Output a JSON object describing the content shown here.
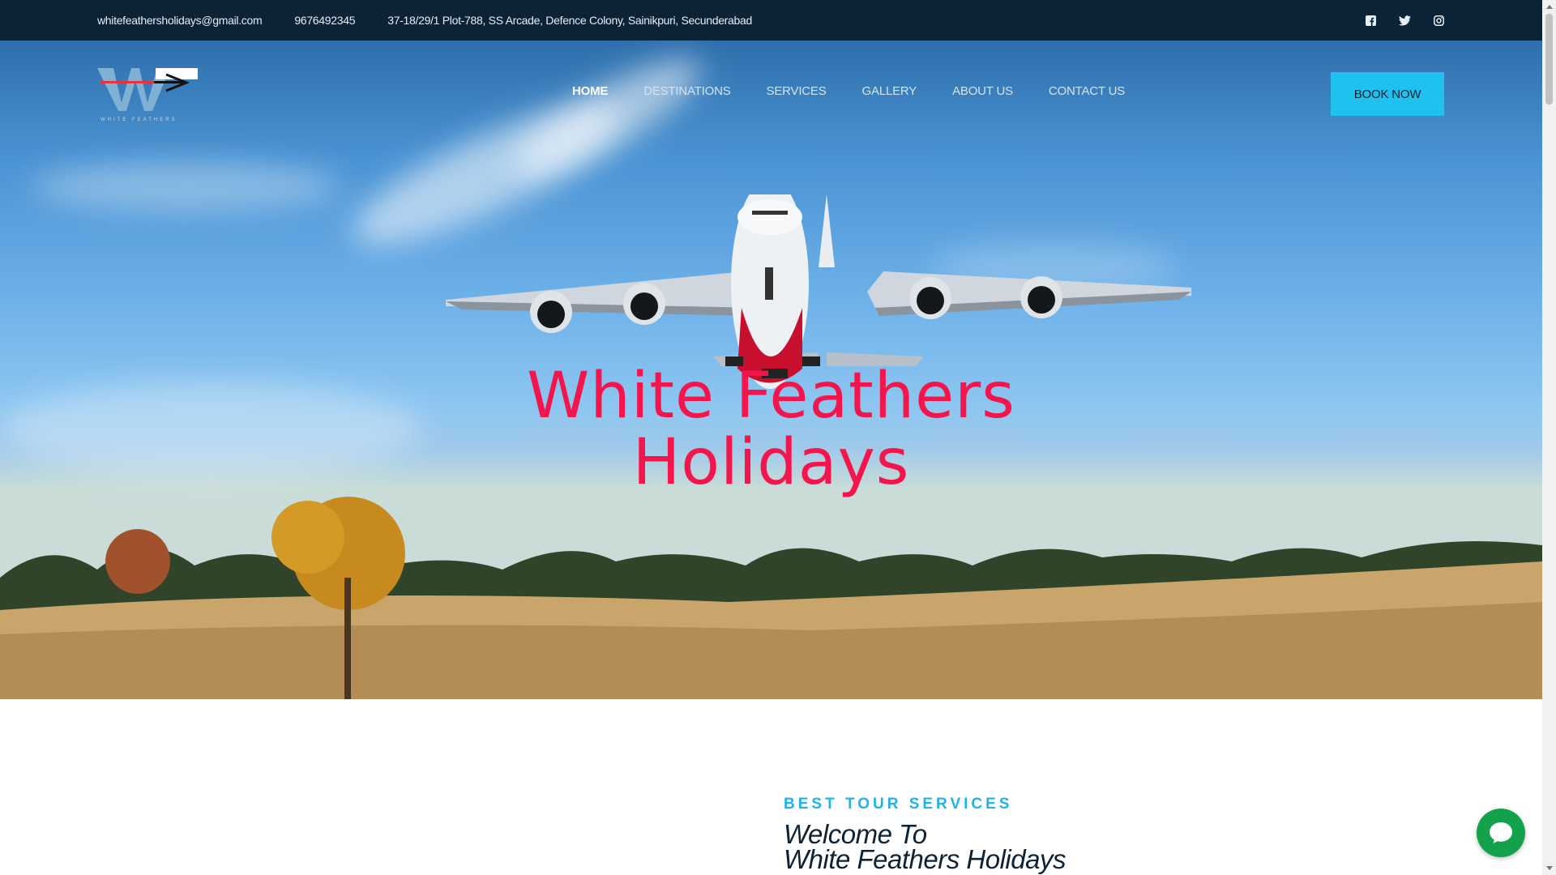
{
  "topbar": {
    "email": "whitefeathersholidays@gmail.com",
    "phone": "9676492345",
    "address": "37-18/29/1 Plot-788, SS Arcade, Defence Colony, Sainikpuri, Secunderabad",
    "social_icons": [
      "facebook-icon",
      "twitter-icon",
      "instagram-icon"
    ]
  },
  "brand": {
    "logo_text": "WHITE FEATHERS"
  },
  "nav": {
    "items": [
      {
        "label": "HOME",
        "active": true
      },
      {
        "label": "DESTINATIONS"
      },
      {
        "label": "SERVICES"
      },
      {
        "label": "GALLERY"
      },
      {
        "label": "ABOUT US"
      },
      {
        "label": "CONTACT US"
      }
    ],
    "cta": "BOOK NOW"
  },
  "hero": {
    "title_line1": "White Feathers",
    "title_line2": "Holidays"
  },
  "welcome": {
    "kicker": "BEST TOUR SERVICES",
    "title_line1": "Welcome To",
    "title_line2": "White Feathers Holidays"
  },
  "colors": {
    "topbar": "#0c2235",
    "accent": "#1fc1ef",
    "hero_title": "#f4154d",
    "chat": "#14a14b"
  }
}
